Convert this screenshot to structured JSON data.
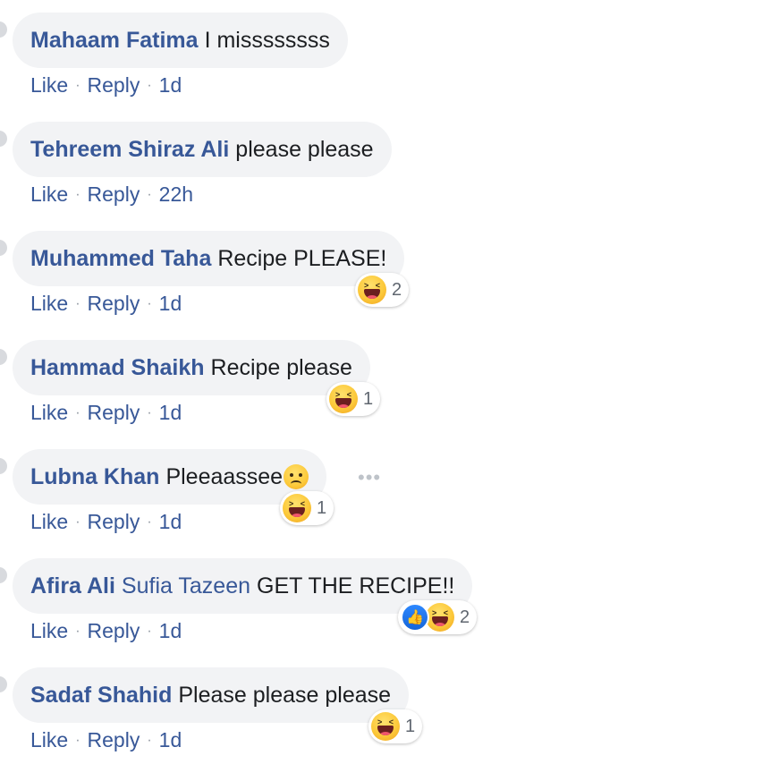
{
  "comments": [
    {
      "author": "Mahaam Fatima",
      "text": "I missssssss",
      "like": "Like",
      "reply": "Reply",
      "sep": "·",
      "time": "1d"
    },
    {
      "author": "Tehreem Shiraz Ali",
      "text": "please please",
      "like": "Like",
      "reply": "Reply",
      "sep": "·",
      "time": "22h"
    },
    {
      "author": "Muhammed Taha",
      "text": "Recipe PLEASE!",
      "like": "Like",
      "reply": "Reply",
      "sep": "·",
      "time": "1d",
      "reaction_count": "2",
      "reactions": [
        "haha"
      ]
    },
    {
      "author": "Hammad Shaikh",
      "text": "Recipe please",
      "like": "Like",
      "reply": "Reply",
      "sep": "·",
      "time": "1d",
      "reaction_count": "1",
      "reactions": [
        "haha"
      ]
    },
    {
      "author": "Lubna Khan",
      "text": "Pleeaassee",
      "emoji": "sad-tear",
      "like": "Like",
      "reply": "Reply",
      "sep": "·",
      "time": "1d",
      "reaction_count": "1",
      "reactions": [
        "haha"
      ],
      "more": "•••"
    },
    {
      "author": "Afira Ali",
      "tag": "Sufia Tazeen",
      "text": "GET THE RECIPE!!",
      "like": "Like",
      "reply": "Reply",
      "sep": "·",
      "time": "1d",
      "reaction_count": "2",
      "reactions": [
        "like",
        "haha"
      ]
    },
    {
      "author": "Sadaf Shahid",
      "text": "Please please please",
      "like": "Like",
      "reply": "Reply",
      "sep": "·",
      "time": "1d",
      "reaction_count": "1",
      "reactions": [
        "haha"
      ]
    }
  ],
  "icons": {
    "like_icon": "👍"
  },
  "colors": {
    "author": "#385898",
    "bubble": "#f2f3f5",
    "text": "#1c1e21",
    "meta": "#606770"
  }
}
